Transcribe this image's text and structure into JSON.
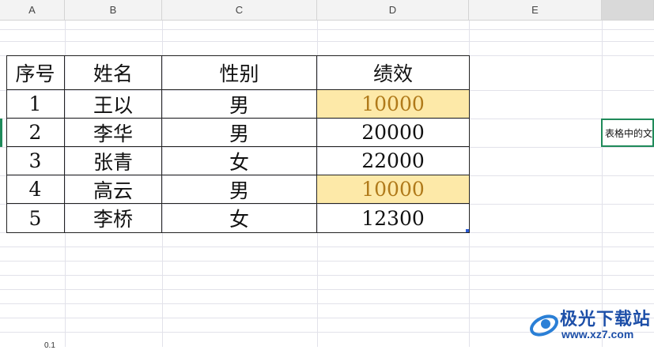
{
  "columns": [
    "A",
    "B",
    "C",
    "D",
    "E"
  ],
  "table": {
    "headers": [
      "序号",
      "姓名",
      "性别",
      "绩效"
    ],
    "rows": [
      {
        "no": "1",
        "name": "王以",
        "gender": "男",
        "score": "10000"
      },
      {
        "no": "2",
        "name": "李华",
        "gender": "男",
        "score": "20000"
      },
      {
        "no": "3",
        "name": "张青",
        "gender": "女",
        "score": "22000"
      },
      {
        "no": "4",
        "name": "高云",
        "gender": "男",
        "score": "10000"
      },
      {
        "no": "5",
        "name": "李桥",
        "gender": "女",
        "score": "12300"
      }
    ]
  },
  "selected_cell_text": "表格中的文",
  "watermark": {
    "title": "极光下载站",
    "url": "www.xz7.com"
  },
  "bottom_label": "0.1",
  "colors": {
    "highlight_fill": "#fde9a8",
    "highlight_text": "#b07a1a",
    "selection": "#1f8a5a"
  }
}
